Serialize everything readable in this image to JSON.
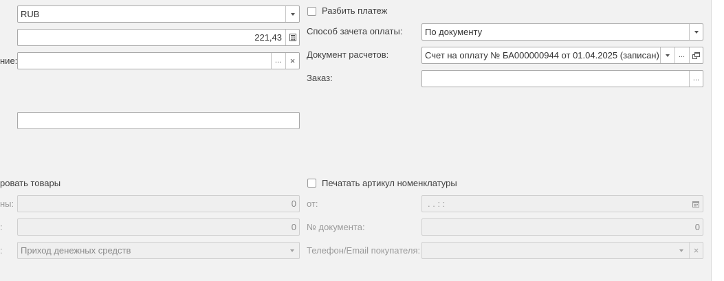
{
  "left": {
    "currency": "RUB",
    "amount": "221,43",
    "purpose_label_tail": "ние:",
    "purpose_value": "",
    "comment_value": "",
    "goods_checkbox_label_tail": "ровать товары",
    "disabled_row1_label_tail": "ны:",
    "disabled_row1_value": "0",
    "disabled_row2_label_tail": ":",
    "disabled_row2_value": "0",
    "disabled_row3_label_tail": ":",
    "disabled_row3_value": "Приход денежных средств"
  },
  "right": {
    "split_payment_label": "Разбить платеж",
    "offset_method_label": "Способ зачета оплаты:",
    "offset_method_value": "По документу",
    "settlement_doc_label": "Документ расчетов:",
    "settlement_doc_value": "Счет на оплату № БА000000944 от 01.04.2025 (записан)",
    "order_label": "Заказ:",
    "order_value": "",
    "print_sku_label": "Печатать артикул номенклатуры",
    "from_label": "от:",
    "from_value": " .  .       :  :",
    "doc_number_label": "№ документа:",
    "doc_number_value": "0",
    "buyer_contact_label": "Телефон/Email покупателя:",
    "buyer_contact_value": ""
  },
  "buttons": {
    "ellipsis": "...",
    "clear": "×"
  }
}
